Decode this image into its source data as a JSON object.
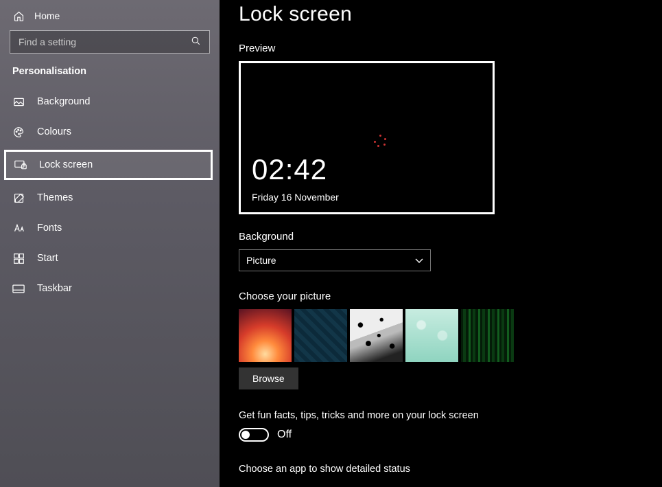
{
  "sidebar": {
    "home": "Home",
    "search_placeholder": "Find a setting",
    "section": "Personalisation",
    "items": [
      {
        "label": "Background"
      },
      {
        "label": "Colours"
      },
      {
        "label": "Lock screen"
      },
      {
        "label": "Themes"
      },
      {
        "label": "Fonts"
      },
      {
        "label": "Start"
      },
      {
        "label": "Taskbar"
      }
    ]
  },
  "page": {
    "title": "Lock screen",
    "preview_label": "Preview",
    "preview_time": "02:42",
    "preview_date": "Friday 16 November",
    "background_label": "Background",
    "background_value": "Picture",
    "choose_label": "Choose your picture",
    "browse_label": "Browse",
    "funfacts_label": "Get fun facts, tips, tricks and more on your lock screen",
    "funfacts_state": "Off",
    "detailed_label": "Choose an app to show detailed status"
  }
}
